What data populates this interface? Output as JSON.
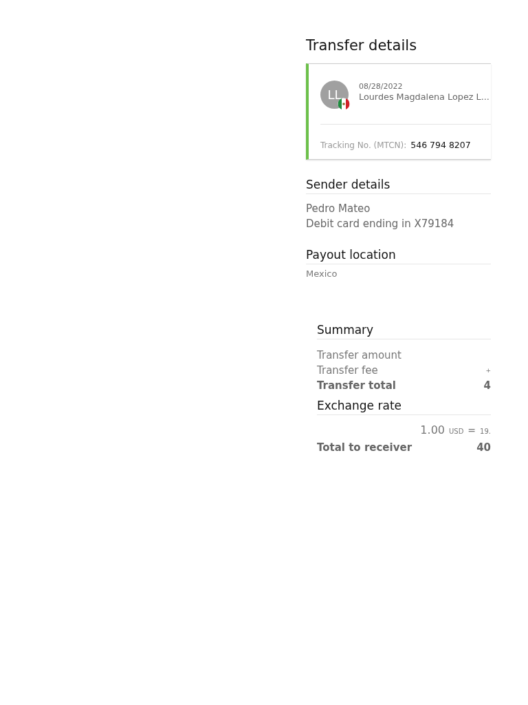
{
  "title": "Transfer details",
  "transfer": {
    "initials": "LL",
    "date": "08/28/2022",
    "recipient": "Lourdes Magdalena Lopez L...",
    "tracking_label": "Tracking No. (MTCN):",
    "tracking_number": "546 794 8207"
  },
  "sender": {
    "heading": "Sender details",
    "lines": [
      "Pedro Mateo",
      "Debit card ending in X79184"
    ]
  },
  "payout": {
    "heading": "Payout location",
    "value": "Mexico"
  },
  "summary": {
    "heading": "Summary",
    "rows": [
      {
        "label": "Transfer amount",
        "kind": "normal"
      },
      {
        "label": "Transfer fee",
        "value": "+",
        "kind": "fee"
      },
      {
        "label": "Transfer total",
        "value": "4",
        "kind": "total"
      }
    ]
  },
  "exchange": {
    "heading": "Exchange rate",
    "amount": "1.00",
    "currency": "USD",
    "equals": "=",
    "rate": "19.",
    "total_label": "Total to receiver",
    "total_value": "40"
  }
}
